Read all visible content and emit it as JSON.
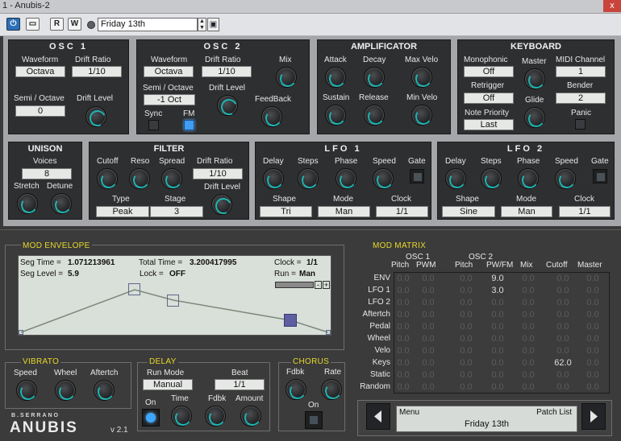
{
  "window": {
    "title": "1 - Anubis-2",
    "close": "x"
  },
  "toolbar": {
    "r_label": "R",
    "w_label": "W",
    "preset": "Friday 13th"
  },
  "osc1": {
    "title": "OSC 1",
    "waveform_label": "Waveform",
    "waveform": "Octava",
    "drift_ratio_label": "Drift Ratio",
    "drift_ratio": "1/10",
    "semi_label": "Semi / Octave",
    "semi": "0",
    "drift_level_label": "Drift Level"
  },
  "osc2": {
    "title": "OSC 2",
    "waveform_label": "Waveform",
    "waveform": "Octava",
    "drift_ratio_label": "Drift Ratio",
    "drift_ratio": "1/10",
    "mix_label": "Mix",
    "semi_label": "Semi / Octave",
    "semi": "-1 Oct",
    "drift_level_label": "Drift Level",
    "feedback_label": "FeedBack",
    "sync_label": "Sync",
    "fm_label": "FM"
  },
  "amp": {
    "title": "AMPLIFICATOR",
    "attack": "Attack",
    "decay": "Decay",
    "max_velo": "Max Velo",
    "sustain": "Sustain",
    "release": "Release",
    "min_velo": "Min Velo"
  },
  "keyboard": {
    "title": "KEYBOARD",
    "mono_label": "Monophonic",
    "mono": "Off",
    "master_label": "Master",
    "midi_label": "MIDI Channel",
    "midi": "1",
    "retrigger_label": "Retrigger",
    "retrigger": "Off",
    "bender_label": "Bender",
    "bender": "2",
    "glide_label": "Glide",
    "note_priority_label": "Note Priority",
    "note_priority": "Last",
    "panic_label": "Panic"
  },
  "unison": {
    "title": "UNISON",
    "voices_label": "Voices",
    "voices": "8",
    "stretch": "Stretch",
    "detune": "Detune"
  },
  "filter": {
    "title": "FILTER",
    "cutoff": "Cutoff",
    "reso": "Reso",
    "spread": "Spread",
    "drift_ratio_label": "Drift Ratio",
    "drift_ratio": "1/10",
    "type_label": "Type",
    "type": "Peak",
    "stage_label": "Stage",
    "stage": "3",
    "drift_level_label": "Drift Level"
  },
  "lfo1": {
    "title": "LFO 1",
    "delay": "Delay",
    "steps": "Steps",
    "phase": "Phase",
    "speed": "Speed",
    "gate": "Gate",
    "shape_label": "Shape",
    "shape": "Tri",
    "mode_label": "Mode",
    "mode": "Man",
    "clock_label": "Clock",
    "clock": "1/1"
  },
  "lfo2": {
    "title": "LFO 2",
    "delay": "Delay",
    "steps": "Steps",
    "phase": "Phase",
    "speed": "Speed",
    "gate": "Gate",
    "shape_label": "Shape",
    "shape": "Sine",
    "mode_label": "Mode",
    "mode": "Man",
    "clock_label": "Clock",
    "clock": "1/1"
  },
  "mod_env": {
    "title": "MOD ENVELOPE",
    "seg_time_label": "Seg Time =",
    "seg_time": "1.071213961",
    "total_time_label": "Total Time =",
    "total_time": "3.200417995",
    "clock_label": "Clock =",
    "clock": "1/1",
    "seg_level_label": "Seg Level =",
    "seg_level": "5.9",
    "lock_label": "Lock =",
    "lock": "OFF",
    "run_label": "Run =",
    "run": "Man",
    "minus": "-",
    "plus": "+"
  },
  "mod_matrix": {
    "title": "MOD MATRIX",
    "group1": "OSC 1",
    "group2": "OSC 2",
    "columns": [
      "Pitch",
      "PWM",
      "Pitch",
      "PW/FM",
      "Mix",
      "Cutoff",
      "Master"
    ],
    "rows": [
      {
        "label": "ENV",
        "values": [
          "0.0",
          "0.0",
          "0.0",
          "9.0",
          "0.0",
          "0.0",
          "0.0"
        ]
      },
      {
        "label": "LFO 1",
        "values": [
          "0.0",
          "0.0",
          "0.0",
          "3.0",
          "0.0",
          "0.0",
          "0.0"
        ]
      },
      {
        "label": "LFO 2",
        "values": [
          "0.0",
          "0.0",
          "0.0",
          "0.0",
          "0.0",
          "0.0",
          "0.0"
        ]
      },
      {
        "label": "Aftertch",
        "values": [
          "0.0",
          "0.0",
          "0.0",
          "0.0",
          "0.0",
          "0.0",
          "0.0"
        ]
      },
      {
        "label": "Pedal",
        "values": [
          "0.0",
          "0.0",
          "0.0",
          "0.0",
          "0.0",
          "0.0",
          "0.0"
        ]
      },
      {
        "label": "Wheel",
        "values": [
          "0.0",
          "0.0",
          "0.0",
          "0.0",
          "0.0",
          "0.0",
          "0.0"
        ]
      },
      {
        "label": "Velo",
        "values": [
          "0.0",
          "0.0",
          "0.0",
          "0.0",
          "0.0",
          "0.0",
          "0.0"
        ]
      },
      {
        "label": "Keys",
        "values": [
          "0.0",
          "0.0",
          "0.0",
          "0.0",
          "0.0",
          "62.0",
          "0.0"
        ]
      },
      {
        "label": "Static",
        "values": [
          "0.0",
          "0.0",
          "0.0",
          "0.0",
          "0.0",
          "0.0",
          "0.0"
        ]
      },
      {
        "label": "Random",
        "values": [
          "0.0",
          "0.0",
          "0.0",
          "0.0",
          "0.0",
          "0.0",
          "0.0"
        ]
      }
    ]
  },
  "vibrato": {
    "title": "VIBRATO",
    "speed": "Speed",
    "wheel": "Wheel",
    "aftertch": "Aftertch"
  },
  "delay": {
    "title": "DELAY",
    "run_mode_label": "Run Mode",
    "run_mode": "Manual",
    "beat_label": "Beat",
    "beat": "1/1",
    "on_label": "On",
    "time": "Time",
    "fdbk": "Fdbk",
    "amount": "Amount"
  },
  "chorus": {
    "title": "CHORUS",
    "fdbk": "Fdbk",
    "rate": "Rate",
    "on_label": "On"
  },
  "brand": {
    "maker": "B.SERRANO",
    "name": "ANUBIS",
    "version": "v 2.1"
  },
  "menu": {
    "left": "Menu",
    "right": "Patch List",
    "patch": "Friday 13th"
  },
  "colors": {
    "accent": "#1db5b2",
    "label_yellow": "#e8d82a",
    "led_blue": "#3f9df5"
  }
}
